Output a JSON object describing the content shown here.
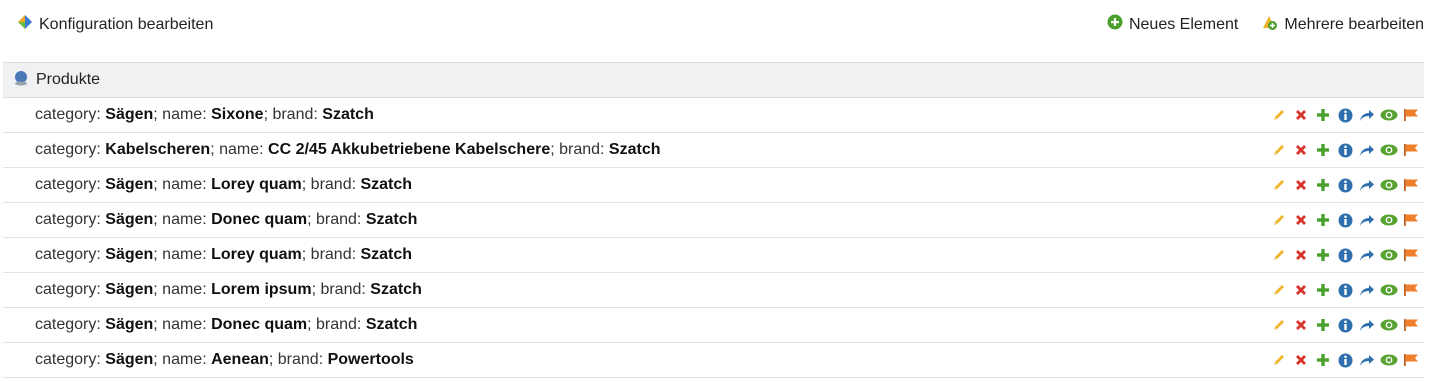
{
  "toolbar": {
    "config_label": "Konfiguration bearbeiten",
    "new_label": "Neues Element",
    "multi_label": "Mehrere bearbeiten"
  },
  "panel": {
    "title": "Produkte",
    "labels": {
      "category": "category: ",
      "name": "; name: ",
      "brand": "; brand: "
    },
    "rows": [
      {
        "category": "Sägen",
        "name": "Sixone",
        "brand": "Szatch"
      },
      {
        "category": "Kabelscheren",
        "name": "CC 2/45 Akkubetriebene Kabelschere",
        "brand": "Szatch"
      },
      {
        "category": "Sägen",
        "name": "Lorey quam",
        "brand": "Szatch"
      },
      {
        "category": "Sägen",
        "name": "Donec quam",
        "brand": "Szatch"
      },
      {
        "category": "Sägen",
        "name": "Lorey quam",
        "brand": "Szatch"
      },
      {
        "category": "Sägen",
        "name": "Lorem ipsum",
        "brand": "Szatch"
      },
      {
        "category": "Sägen",
        "name": "Donec quam",
        "brand": "Szatch"
      },
      {
        "category": "Sägen",
        "name": "Aenean",
        "brand": "Powertools"
      }
    ]
  },
  "icons": {
    "row_actions": [
      "pencil-icon",
      "delete-icon",
      "add-icon",
      "info-icon",
      "move-icon",
      "view-icon",
      "flag-icon"
    ],
    "colors": {
      "pencil": "#f0b429",
      "delete": "#d9342b",
      "add": "#4aa02c",
      "info": "#2f6fad",
      "move": "#2f6fad",
      "view": "#58a332",
      "flag": "#f07f2c"
    }
  }
}
